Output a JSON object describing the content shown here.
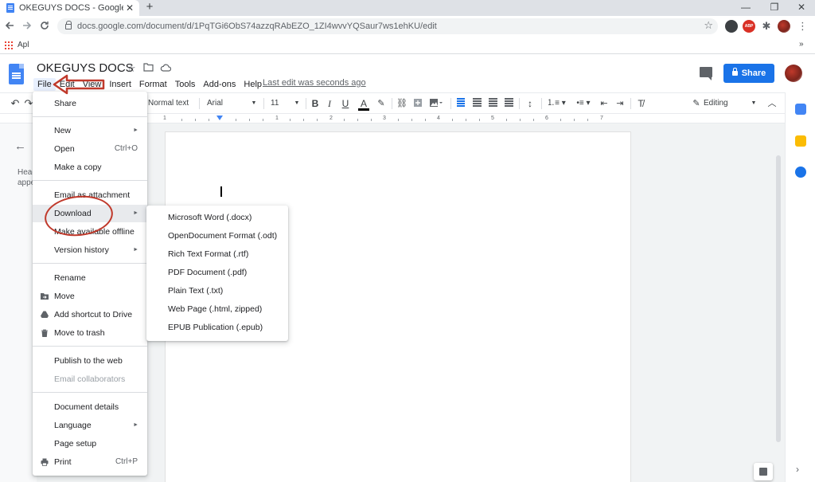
{
  "browser": {
    "tab_title": "OKEGUYS DOCS - Google Docs",
    "tab_close": "✕",
    "new_tab": "+",
    "window_controls": [
      "—",
      "❐",
      "✕"
    ],
    "address": "docs.google.com/document/d/1PqTGi6ObS74azzqRAbEZO_1ZI4wvvYQSaur7ws1ehKU/edit",
    "bookmark_label": "Apl",
    "bookmark_more": "»",
    "ext_abp": "ABP",
    "nav_icons": [
      "arrow-left-icon",
      "arrow-right-icon",
      "reload-icon"
    ]
  },
  "docs": {
    "title": "OKEGUYS DOCS",
    "menubar": [
      "File",
      "Edit",
      "View",
      "Insert",
      "Format",
      "Tools",
      "Add-ons",
      "Help"
    ],
    "last_edit": "Last edit was seconds ago",
    "share": "Share"
  },
  "toolbar": {
    "style": "Normal text",
    "font": "Arial",
    "size": "11",
    "bold": "B",
    "italic": "I",
    "underline": "U",
    "text_color": "A",
    "mode": "Editing"
  },
  "ruler": {
    "numbers": [
      "1",
      "1",
      "2",
      "3",
      "4",
      "5",
      "6",
      "7"
    ]
  },
  "outline": {
    "hint_line1": "Head",
    "hint_line2": "appe"
  },
  "file_menu": {
    "items": [
      {
        "label": "Share",
        "shortcut": "",
        "submenu": false,
        "disabled": false
      },
      {
        "label": "New",
        "shortcut": "",
        "submenu": true,
        "disabled": false
      },
      {
        "label": "Open",
        "shortcut": "Ctrl+O",
        "submenu": false,
        "disabled": false
      },
      {
        "label": "Make a copy",
        "shortcut": "",
        "submenu": false,
        "disabled": false
      },
      {
        "label": "Email as attachment",
        "shortcut": "",
        "submenu": false,
        "disabled": false
      },
      {
        "label": "Download",
        "shortcut": "",
        "submenu": true,
        "disabled": false
      },
      {
        "label": "Make available offline",
        "shortcut": "",
        "submenu": false,
        "disabled": false
      },
      {
        "label": "Version history",
        "shortcut": "",
        "submenu": true,
        "disabled": false
      },
      {
        "label": "Rename",
        "shortcut": "",
        "submenu": false,
        "disabled": false
      },
      {
        "label": "Move",
        "shortcut": "",
        "submenu": false,
        "disabled": false
      },
      {
        "label": "Add shortcut to Drive",
        "shortcut": "",
        "submenu": false,
        "disabled": false
      },
      {
        "label": "Move to trash",
        "shortcut": "",
        "submenu": false,
        "disabled": false
      },
      {
        "label": "Publish to the web",
        "shortcut": "",
        "submenu": false,
        "disabled": false
      },
      {
        "label": "Email collaborators",
        "shortcut": "",
        "submenu": false,
        "disabled": true
      },
      {
        "label": "Document details",
        "shortcut": "",
        "submenu": false,
        "disabled": false
      },
      {
        "label": "Language",
        "shortcut": "",
        "submenu": true,
        "disabled": false
      },
      {
        "label": "Page setup",
        "shortcut": "",
        "submenu": false,
        "disabled": false
      },
      {
        "label": "Print",
        "shortcut": "Ctrl+P",
        "submenu": false,
        "disabled": false
      }
    ]
  },
  "download_menu": {
    "items": [
      "Microsoft Word (.docx)",
      "OpenDocument Format (.odt)",
      "Rich Text Format (.rtf)",
      "PDF Document (.pdf)",
      "Plain Text (.txt)",
      "Web Page (.html, zipped)",
      "EPUB Publication (.epub)"
    ]
  },
  "colors": {
    "accent": "#1a73e8",
    "annotation": "#c0392b"
  }
}
